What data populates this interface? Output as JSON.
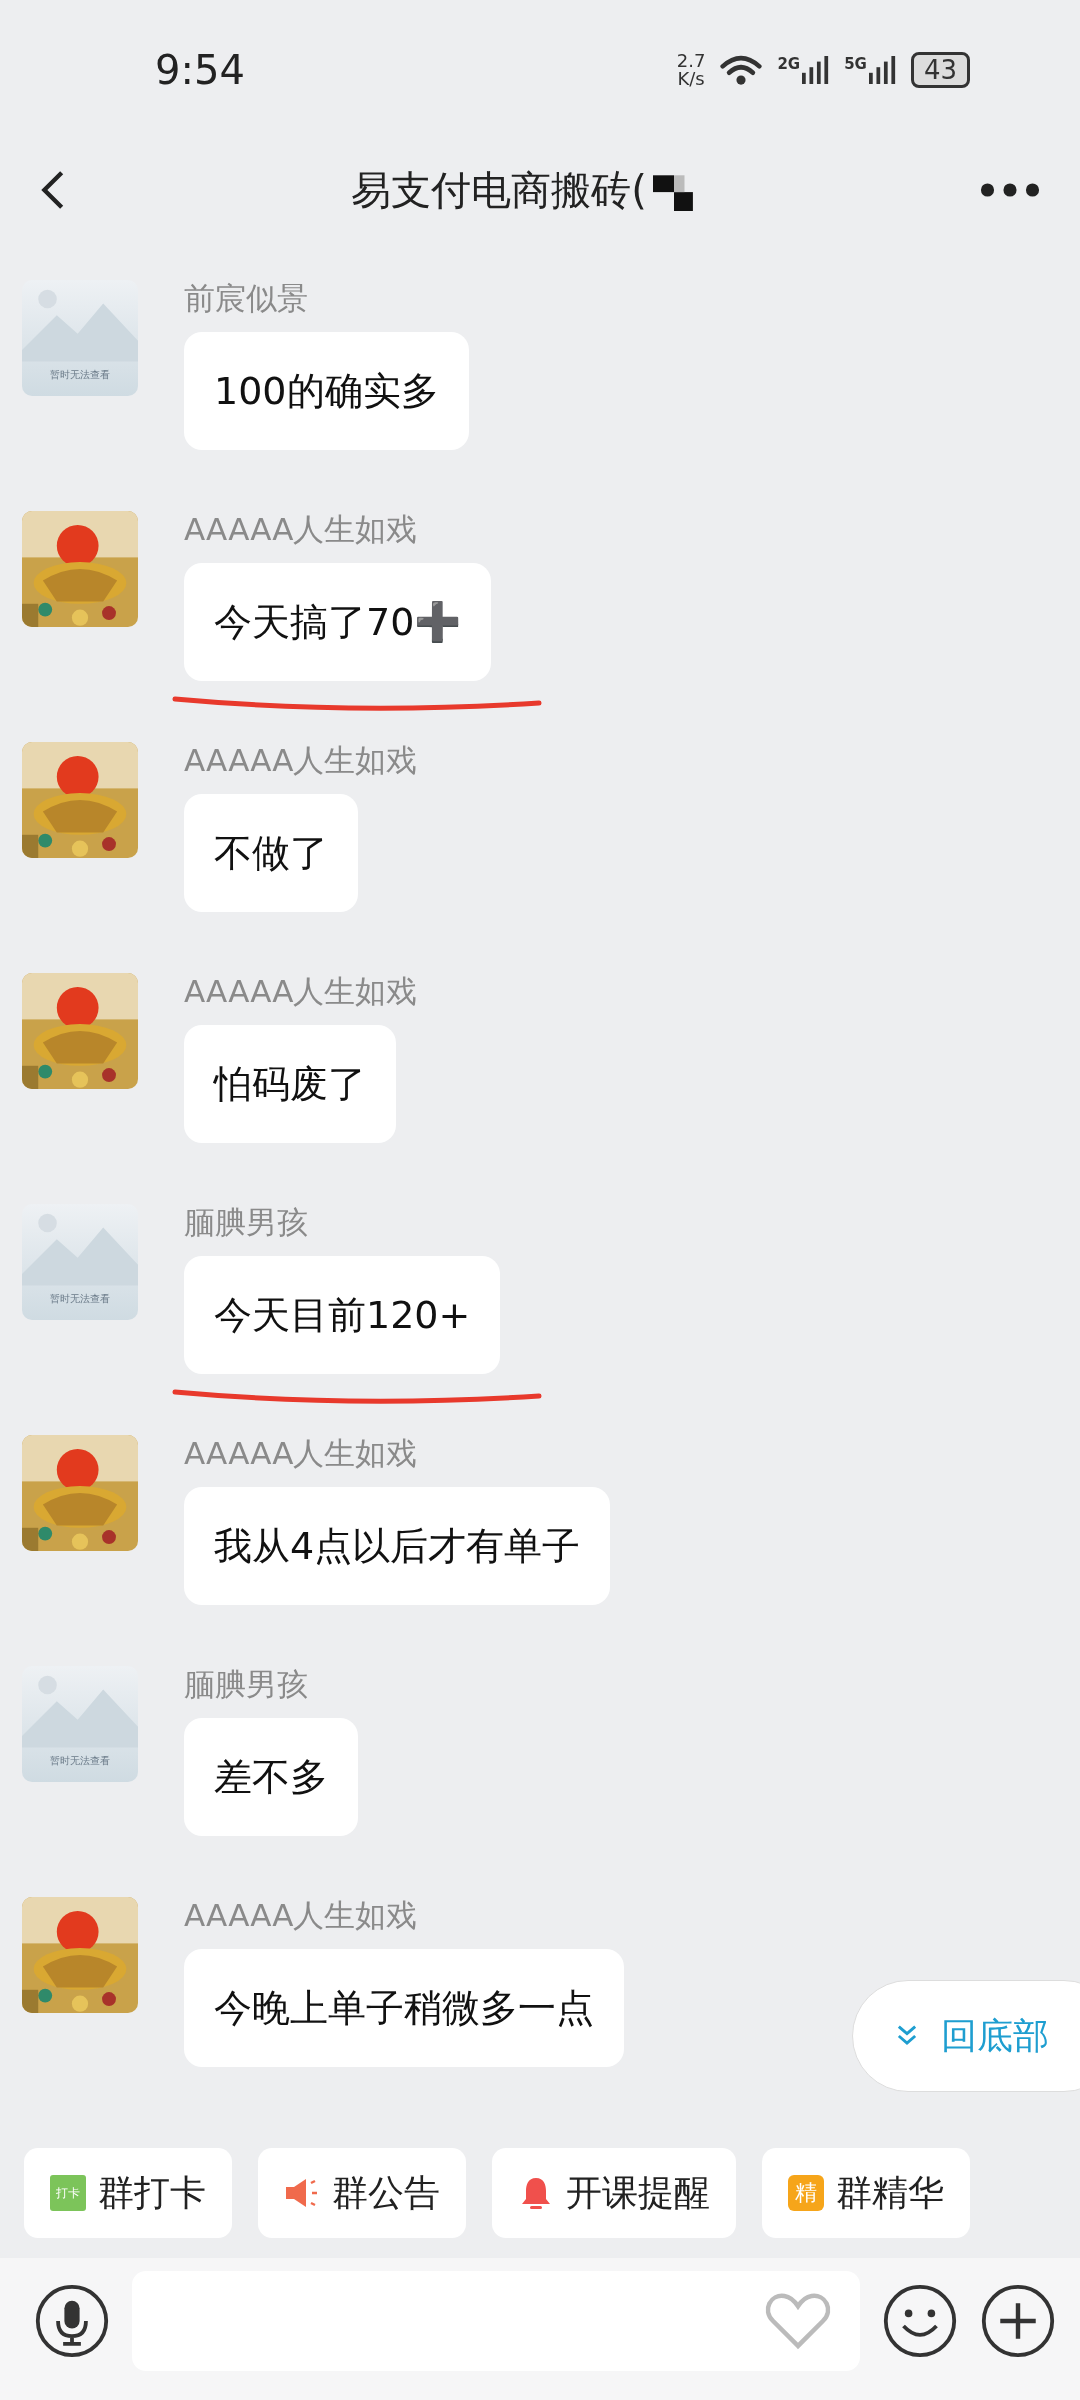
{
  "status_bar": {
    "time": "9:54",
    "speed_value": "2.7",
    "speed_unit": "K/s",
    "net_1": "2G",
    "net_2": "5G",
    "battery": "43"
  },
  "header": {
    "title": "易支付电商搬砖(",
    "title_redacted": true
  },
  "messages": [
    {
      "sender": "前宸似景",
      "avatar": {
        "kind": "placeholder",
        "caption": "暂时无法查看"
      },
      "text": "100的确实多",
      "underlined": false
    },
    {
      "sender": "AAAAA人生如戏",
      "text": "今天搞了70➕",
      "underlined": true
    },
    {
      "sender": "AAAAA人生如戏",
      "text": "不做了",
      "underlined": false
    },
    {
      "sender": "AAAAA人生如戏",
      "text": "怕码废了",
      "underlined": false
    },
    {
      "sender": "腼腆男孩",
      "avatar": {
        "kind": "placeholder",
        "caption": "暂时无法查看"
      },
      "text": "今天目前120+",
      "underlined": true
    },
    {
      "sender": "AAAAA人生如戏",
      "text": "我从4点以后才有单子",
      "underlined": false
    },
    {
      "sender": "腼腆男孩",
      "avatar": {
        "kind": "placeholder",
        "caption": "暂时无法查看"
      },
      "text": "差不多",
      "underlined": false
    },
    {
      "sender": "AAAAA人生如戏",
      "text": "今晚上单子稍微多一点",
      "underlined": false
    }
  ],
  "jump_to_bottom": {
    "label": "回底部"
  },
  "quick_actions": [
    {
      "kind": "checkin",
      "label": "群打卡",
      "icon_text": "打卡"
    },
    {
      "kind": "notice",
      "label": "群公告"
    },
    {
      "kind": "reminder",
      "label": "开课提醒"
    },
    {
      "kind": "essence",
      "label": "群精华",
      "icon_text": "精"
    }
  ]
}
